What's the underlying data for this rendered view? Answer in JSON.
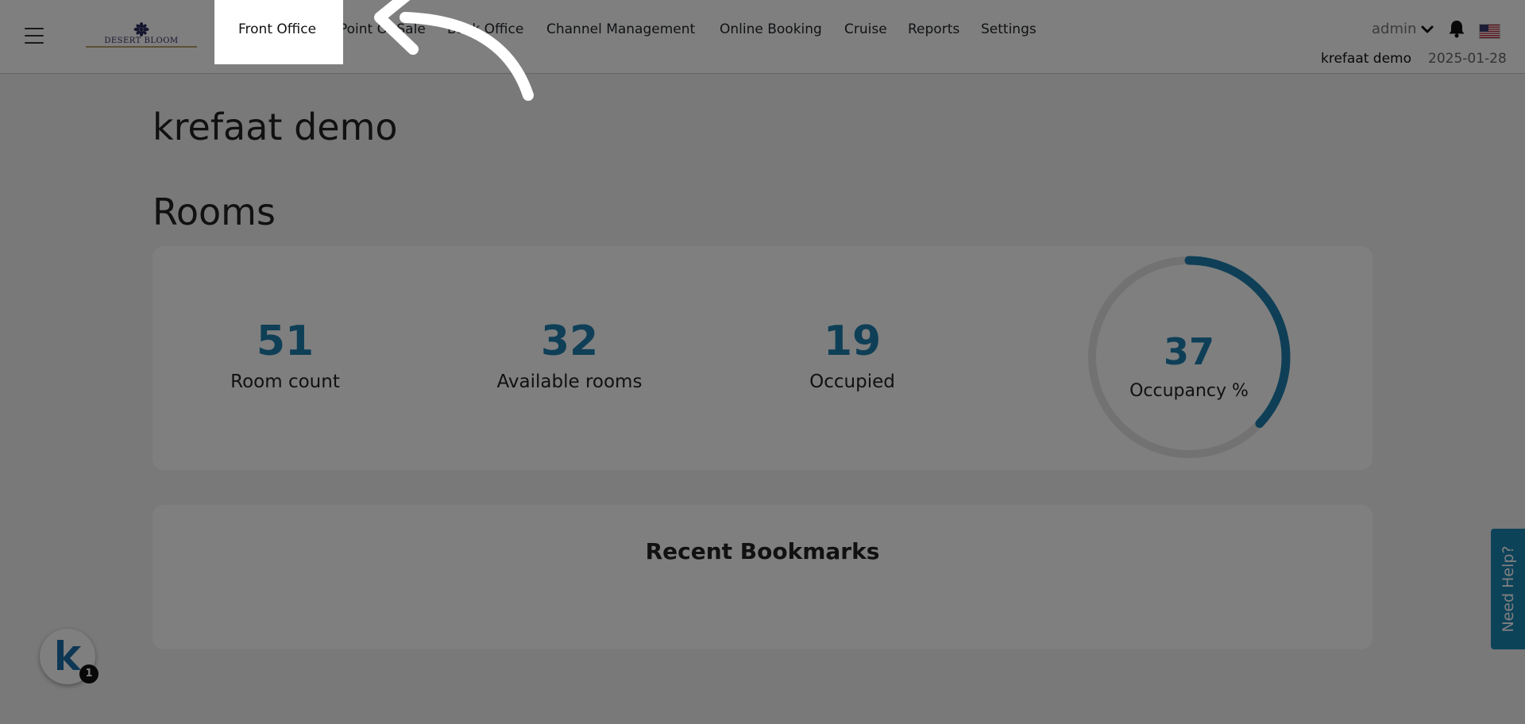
{
  "header": {
    "logo_text": "DESERT BLOOM",
    "nav": [
      {
        "label": "Front Office"
      },
      {
        "label": "Point Of Sale"
      },
      {
        "label": "Back Office"
      },
      {
        "label": "Channel Management"
      },
      {
        "label": "Online Booking"
      },
      {
        "label": "Cruise"
      },
      {
        "label": "Reports"
      },
      {
        "label": "Settings"
      }
    ],
    "user": "admin",
    "hotel": "krefaat demo",
    "date": "2025-01-28"
  },
  "page": {
    "title": "krefaat demo",
    "rooms_title": "Rooms"
  },
  "rooms": {
    "room_count": {
      "value": "51",
      "label": "Room count"
    },
    "available": {
      "value": "32",
      "label": "Available rooms"
    },
    "occupied": {
      "value": "19",
      "label": "Occupied"
    },
    "occupancy": {
      "value": "37",
      "label": "Occupancy %",
      "percent": 37
    }
  },
  "bookmarks": {
    "title": "Recent Bookmarks"
  },
  "help": {
    "label": "Need Help?"
  },
  "widget": {
    "badge": "1"
  },
  "colors": {
    "accent": "#1d7fae",
    "help_tab": "#1a86b3",
    "overlay": "rgba(0,0,0,0.5)"
  },
  "icons": {
    "menu": "hamburger-icon",
    "user_menu": "chevron-down-icon",
    "notifications": "bell-icon",
    "language": "us-flag-icon",
    "tour": "curved-arrow-icon"
  }
}
